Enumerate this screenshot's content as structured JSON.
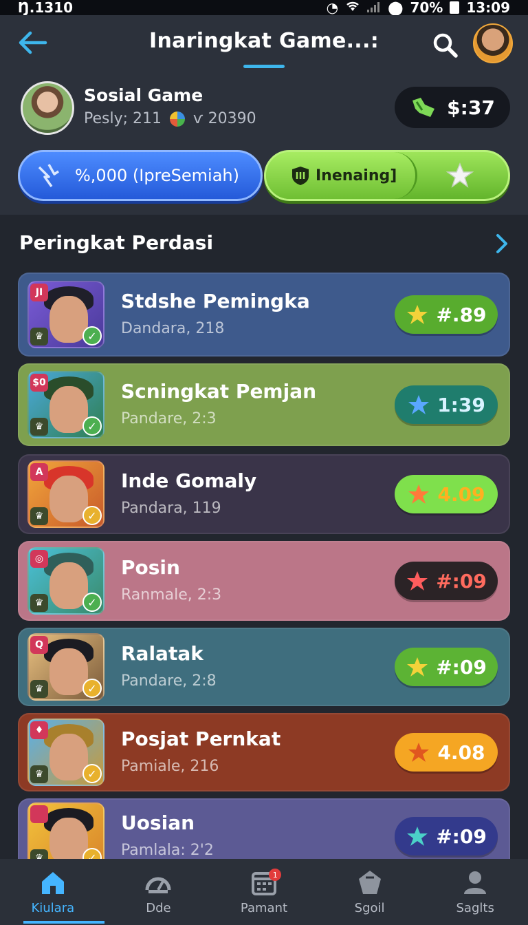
{
  "status_bar": {
    "left_text": "Ŋ.1310",
    "battery": "70%",
    "time": "13:09"
  },
  "header": {
    "title": "Inaringkat Game...:"
  },
  "profile": {
    "name": "Sosial Game",
    "stat1": "Pesly; 211",
    "stat2": "ѵ 20390",
    "balance": "$:37"
  },
  "promos": {
    "blue_label": "%,000  (IpreSemiah)",
    "green_label": "Inenaing]"
  },
  "section": {
    "title": "Peringkat Perdasi"
  },
  "leaderboard": [
    {
      "name": "Stdshe Pemingka",
      "sub": "Dandara, 218",
      "score": "#.89",
      "badge": "JI",
      "row_color": "#3e5a8c",
      "pill_color": "#58ac2e",
      "pill_text_color": "#ffffff",
      "icon_color": "#f4d23a",
      "check_color": "#4caf50"
    },
    {
      "name": "Scningkat Pemjan",
      "sub": "Pandare, 2:3",
      "score": "1:39",
      "badge": "$0",
      "row_color": "#7ea04e",
      "pill_color": "#1f7d6d",
      "pill_text_color": "#d8f3ff",
      "icon_color": "#5aa7ff",
      "check_color": "#4caf50"
    },
    {
      "name": "Inde Gomaly",
      "sub": "Pandara, 119",
      "score": "4.09",
      "badge": "A",
      "row_color": "#3a3449",
      "pill_color": "#7fe04c",
      "pill_text_color": "#ffb020",
      "icon_color": "#ff7a3a",
      "check_color": "#e8b12d"
    },
    {
      "name": "Posin",
      "sub": "Ranmale, 2:3",
      "score": "#:09",
      "badge": "◎",
      "row_color": "#bb7688",
      "pill_color": "#2b2326",
      "pill_text_color": "#ff6b5e",
      "icon_color": "#ff5d5d",
      "check_color": "#4caf50"
    },
    {
      "name": "Ralatak",
      "sub": "Pandare, 2:8",
      "score": "#:09",
      "badge": "Q",
      "row_color": "#3f6e7e",
      "pill_color": "#5cb334",
      "pill_text_color": "#ffffff",
      "icon_color": "#f4d23a",
      "check_color": "#e8b12d"
    },
    {
      "name": "Posjat Pernkat",
      "sub": "Pamiale, 216",
      "score": "4.08",
      "badge": "♦",
      "row_color": "#8d3a24",
      "pill_color": "#f5a623",
      "pill_text_color": "#ffffff",
      "icon_color": "#e0561f",
      "check_color": "#e8b12d"
    },
    {
      "name": "Uosian",
      "sub": "Pamlala: 2'2",
      "score": "#:09",
      "badge": "",
      "row_color": "#5c5a94",
      "pill_color": "#333a8c",
      "pill_text_color": "#ffffff",
      "icon_color": "#4bd1c8",
      "check_color": "#e8b12d"
    }
  ],
  "bottom_nav": [
    {
      "label": "Kiulara",
      "icon": "home-icon",
      "active": true
    },
    {
      "label": "Dde",
      "icon": "speed-icon",
      "active": false
    },
    {
      "label": "Pamant",
      "icon": "calendar-icon",
      "active": false,
      "badge": "1"
    },
    {
      "label": "Sgoil",
      "icon": "tag-icon",
      "active": false
    },
    {
      "label": "Saglts",
      "icon": "user-icon",
      "active": false
    }
  ]
}
